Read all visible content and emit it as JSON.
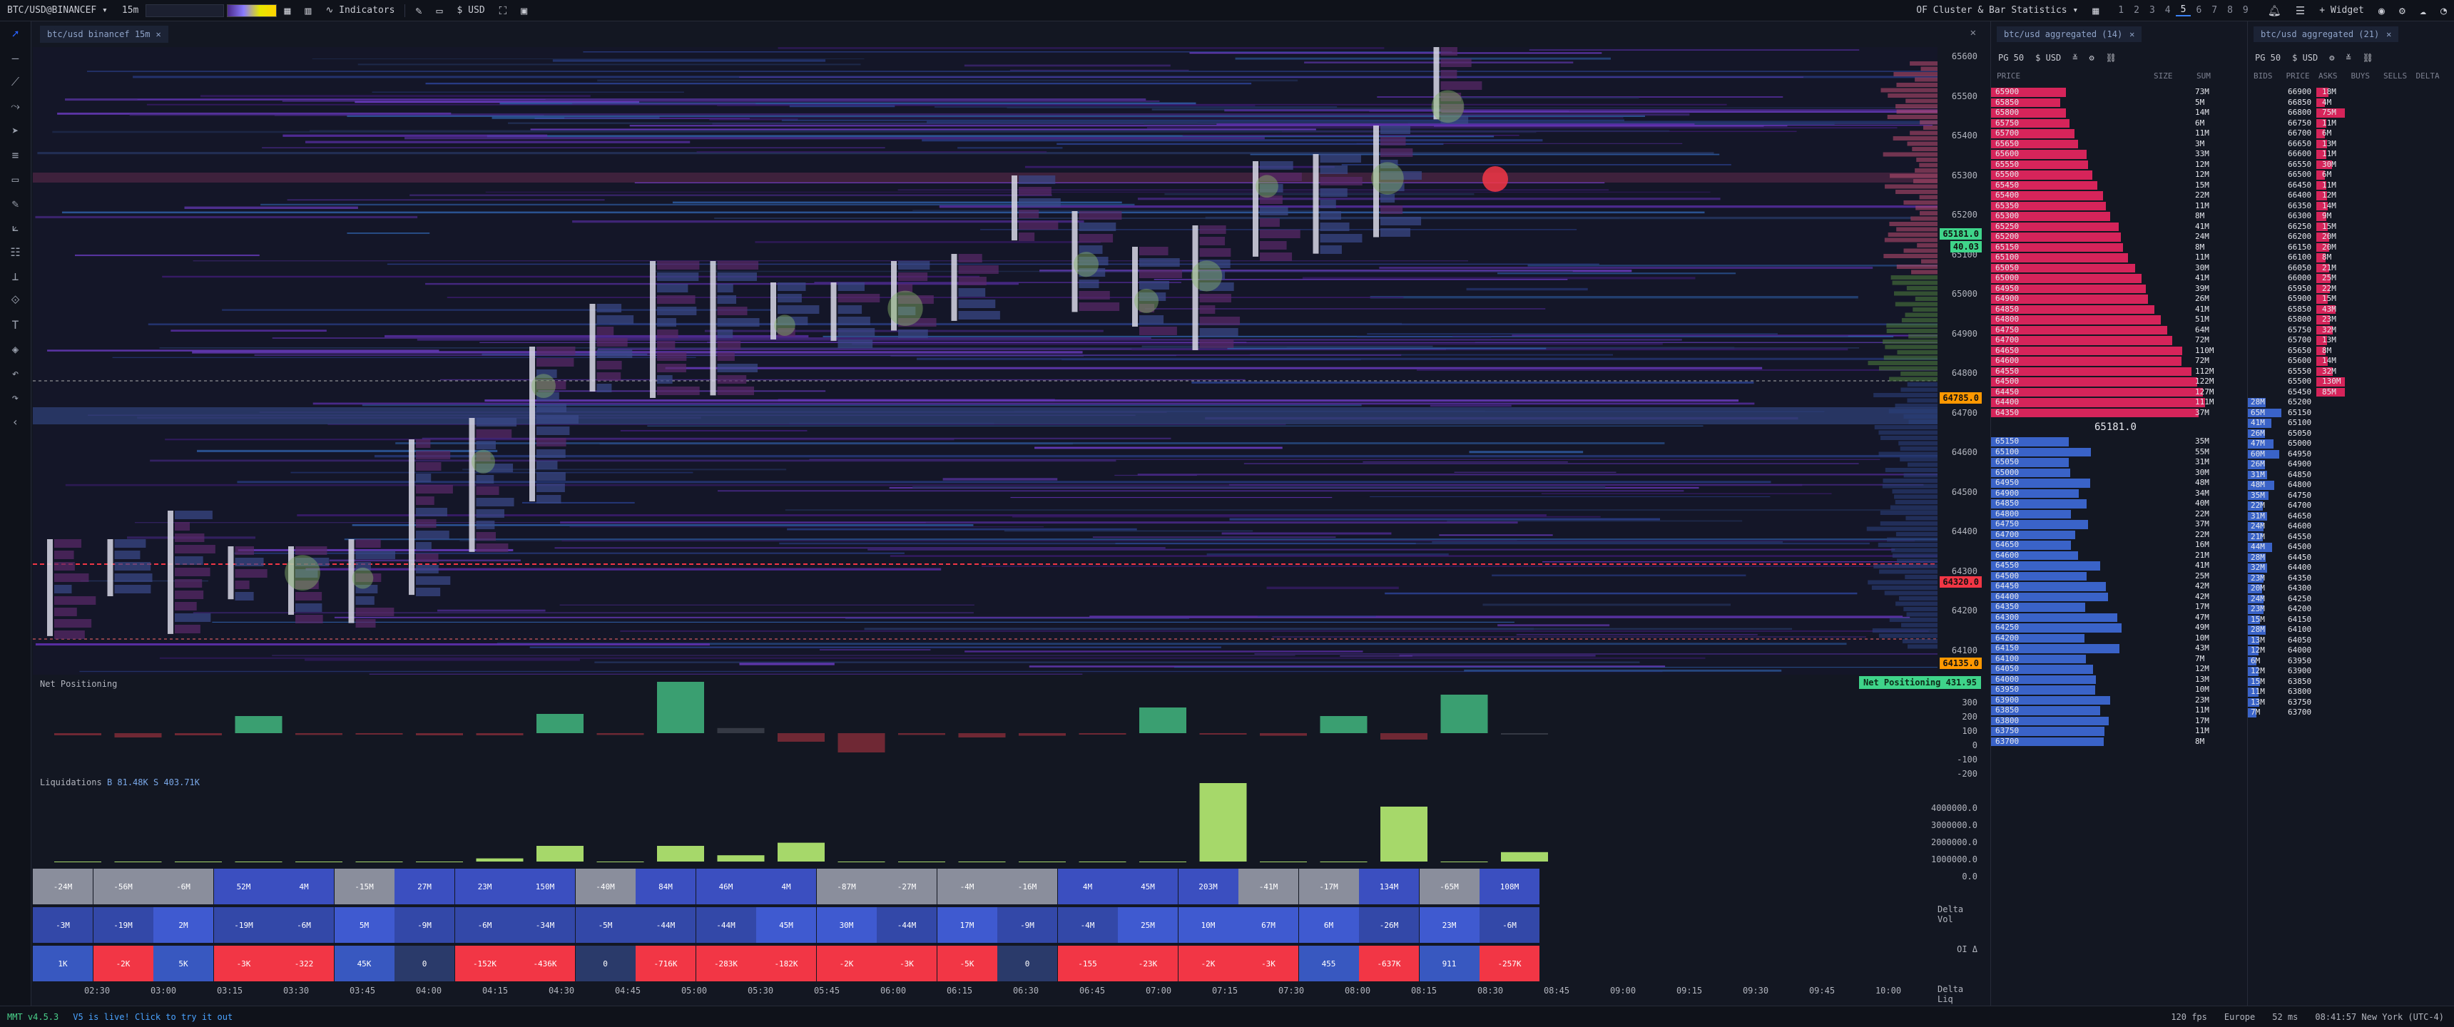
{
  "topbar": {
    "symbol": "BTC/USD@BINANCEF",
    "timeframe": "15m",
    "indicators_label": "Indicators",
    "currency_label": "USD",
    "tool_title": "OF Cluster & Bar Statistics",
    "workspaces": [
      "1",
      "2",
      "3",
      "4",
      "5",
      "6",
      "7",
      "8",
      "9"
    ],
    "active_workspace": "5",
    "widget_label": "Widget"
  },
  "chart": {
    "tab_label": "btc/usd binancef 15m",
    "price_labels": [
      "65600",
      "65500",
      "65400",
      "65300",
      "65200",
      "65100",
      "65000",
      "64900",
      "64800",
      "64700",
      "64600",
      "64500",
      "64400",
      "64300",
      "64200",
      "64100"
    ],
    "markers": [
      {
        "text": "65181.0",
        "color": "#3fd48a"
      },
      {
        "text": "40.03",
        "color": "#3fd48a"
      },
      {
        "text": "64785.0",
        "color": "#ff9800"
      },
      {
        "text": "64320.0",
        "color": "#f23645"
      },
      {
        "text": "64135.0",
        "color": "#ff9800"
      }
    ],
    "net_positioning": {
      "title": "Net Positioning",
      "badge": "Net Positioning 431.95",
      "axis": [
        "300",
        "200",
        "100",
        "0",
        "-100",
        "-200"
      ]
    },
    "liquidations": {
      "title": "Liquidations",
      "buy": "B 81.48K",
      "sell": "S 403.71K",
      "axis": [
        "4000000.0",
        "3000000.0",
        "2000000.0",
        "1000000.0",
        "0.0"
      ]
    },
    "row_labels": [
      "Delta Vol",
      "OI Δ",
      "Delta Liq"
    ],
    "time_labels": [
      "02:30",
      "03:00",
      "03:15",
      "03:30",
      "03:45",
      "04:00",
      "04:15",
      "04:30",
      "04:45",
      "05:00",
      "05:30",
      "05:45",
      "06:00",
      "06:15",
      "06:30",
      "06:45",
      "07:00",
      "07:15",
      "07:30",
      "08:00",
      "08:15",
      "08:30",
      "08:45",
      "09:00",
      "09:15",
      "09:30",
      "09:45",
      "10:00"
    ],
    "delta_vol": [
      "-24M",
      "-56M",
      "-6M",
      "52M",
      "4M",
      "-15M",
      "27M",
      "23M",
      "150M",
      "-40M",
      "84M",
      "46M",
      "4M",
      "-87M",
      "-27M",
      "-4M",
      "-16M",
      "4M",
      "45M",
      "203M",
      "-41M",
      "-17M",
      "134M",
      "-65M",
      "108M"
    ],
    "oi_delta": [
      "-3M",
      "-19M",
      "2M",
      "-19M",
      "-6M",
      "5M",
      "-9M",
      "-6M",
      "-34M",
      "-5M",
      "-44M",
      "-44M",
      "45M",
      "30M",
      "-44M",
      "17M",
      "-9M",
      "-4M",
      "25M",
      "10M",
      "67M",
      "6M",
      "-26M",
      "23M",
      "-6M"
    ],
    "delta_liq": [
      "1K",
      "-2K",
      "5K",
      "-3K",
      "-322",
      "45K",
      "0",
      "-152K",
      "-436K",
      "0",
      "-716K",
      "-283K",
      "-182K",
      "-2K",
      "-3K",
      "-5K",
      "0",
      "-155",
      "-23K",
      "-2K",
      "-3K",
      "455",
      "-637K",
      "911",
      "-257K"
    ]
  },
  "dom1": {
    "tab_label": "btc/usd aggregated (14)",
    "controls": [
      "PG 50",
      "$ USD"
    ],
    "cols": [
      "PRICE",
      "SIZE",
      "SUM"
    ],
    "asks": [
      [
        "65900",
        "73M"
      ],
      [
        "65850",
        "5M"
      ],
      [
        "65800",
        "14M"
      ],
      [
        "65750",
        "6M"
      ],
      [
        "65700",
        "11M"
      ],
      [
        "65650",
        "3M"
      ],
      [
        "65600",
        "33M"
      ],
      [
        "65550",
        "12M"
      ],
      [
        "65500",
        "12M"
      ],
      [
        "65450",
        "15M"
      ],
      [
        "65400",
        "22M"
      ],
      [
        "65350",
        "11M"
      ],
      [
        "65300",
        "8M"
      ],
      [
        "65250",
        "41M"
      ],
      [
        "65200",
        "24M"
      ],
      [
        "65150",
        "8M"
      ],
      [
        "65100",
        "11M"
      ],
      [
        "65050",
        "30M"
      ],
      [
        "65000",
        "41M"
      ],
      [
        "64950",
        "39M"
      ],
      [
        "64900",
        "26M"
      ],
      [
        "64850",
        "41M"
      ],
      [
        "64800",
        "51M"
      ],
      [
        "64750",
        "64M"
      ],
      [
        "64700",
        "72M"
      ],
      [
        "64650",
        "110M"
      ],
      [
        "64600",
        "72M"
      ],
      [
        "64550",
        "112M"
      ],
      [
        "64500",
        "122M"
      ],
      [
        "64450",
        "127M"
      ],
      [
        "64400",
        "111M"
      ],
      [
        "64350",
        "37M"
      ]
    ],
    "mid_price": "65181.0",
    "bids": [
      [
        "65150",
        "35M"
      ],
      [
        "65100",
        "55M"
      ],
      [
        "65050",
        "31M"
      ],
      [
        "65000",
        "30M"
      ],
      [
        "64950",
        "48M"
      ],
      [
        "64900",
        "34M"
      ],
      [
        "64850",
        "40M"
      ],
      [
        "64800",
        "22M"
      ],
      [
        "64750",
        "37M"
      ],
      [
        "64700",
        "22M"
      ],
      [
        "64650",
        "16M"
      ],
      [
        "64600",
        "21M"
      ],
      [
        "64550",
        "41M"
      ],
      [
        "64500",
        "25M"
      ],
      [
        "64450",
        "42M"
      ],
      [
        "64400",
        "42M"
      ],
      [
        "64350",
        "17M"
      ],
      [
        "64300",
        "47M"
      ],
      [
        "64250",
        "49M"
      ],
      [
        "64200",
        "10M"
      ],
      [
        "64150",
        "43M"
      ],
      [
        "64100",
        "7M"
      ],
      [
        "64050",
        "12M"
      ],
      [
        "64000",
        "13M"
      ],
      [
        "63950",
        "10M"
      ],
      [
        "63900",
        "23M"
      ],
      [
        "63850",
        "11M"
      ],
      [
        "63800",
        "17M"
      ],
      [
        "63750",
        "11M"
      ],
      [
        "63700",
        "8M"
      ]
    ]
  },
  "dom2": {
    "tab_label": "btc/usd aggregated (21)",
    "controls": [
      "PG 50",
      "$ USD"
    ],
    "cols": [
      "BIDS",
      "PRICE",
      "ASKS",
      "BUYS",
      "SELLS",
      "DELTA"
    ],
    "asks": [
      [
        "66900",
        "18M"
      ],
      [
        "66850",
        "4M"
      ],
      [
        "66800",
        "75M"
      ],
      [
        "66750",
        "11M"
      ],
      [
        "66700",
        "6M"
      ],
      [
        "66650",
        "13M"
      ],
      [
        "66600",
        "11M"
      ],
      [
        "66550",
        "30M"
      ],
      [
        "66500",
        "6M"
      ],
      [
        "66450",
        "11M"
      ],
      [
        "66400",
        "12M"
      ],
      [
        "66350",
        "14M"
      ],
      [
        "66300",
        "9M"
      ],
      [
        "66250",
        "15M"
      ],
      [
        "66200",
        "20M"
      ],
      [
        "66150",
        "20M"
      ],
      [
        "66100",
        "8M"
      ],
      [
        "66050",
        "21M"
      ],
      [
        "66000",
        "25M"
      ],
      [
        "65950",
        "22M"
      ],
      [
        "65900",
        "15M"
      ],
      [
        "65850",
        "43M"
      ],
      [
        "65800",
        "23M"
      ],
      [
        "65750",
        "32M"
      ],
      [
        "65700",
        "13M"
      ],
      [
        "65650",
        "8M"
      ],
      [
        "65600",
        "14M"
      ],
      [
        "65550",
        "32M"
      ],
      [
        "65500",
        "130M"
      ],
      [
        "65450",
        "85M"
      ]
    ],
    "bids": [
      [
        "65200",
        "28M"
      ],
      [
        "65150",
        "65M"
      ],
      [
        "65100",
        "41M"
      ],
      [
        "65050",
        "26M"
      ],
      [
        "65000",
        "47M"
      ],
      [
        "64950",
        "60M"
      ],
      [
        "64900",
        "26M"
      ],
      [
        "64850",
        "31M"
      ],
      [
        "64800",
        "48M"
      ],
      [
        "64750",
        "35M"
      ],
      [
        "64700",
        "22M"
      ],
      [
        "64650",
        "31M"
      ],
      [
        "64600",
        "24M"
      ],
      [
        "64550",
        "21M"
      ],
      [
        "64500",
        "44M"
      ],
      [
        "64450",
        "28M"
      ],
      [
        "64400",
        "32M"
      ],
      [
        "64350",
        "23M"
      ],
      [
        "64300",
        "20M"
      ],
      [
        "64250",
        "24M"
      ],
      [
        "64200",
        "23M"
      ],
      [
        "64150",
        "15M"
      ],
      [
        "64100",
        "28M"
      ],
      [
        "64050",
        "13M"
      ],
      [
        "64000",
        "12M"
      ],
      [
        "63950",
        "6M"
      ],
      [
        "63900",
        "12M"
      ],
      [
        "63850",
        "15M"
      ],
      [
        "63800",
        "11M"
      ],
      [
        "63750",
        "13M"
      ],
      [
        "63700",
        "7M"
      ]
    ]
  },
  "statusbar": {
    "version": "MMT v4.5.3",
    "live_msg": "V5 is live! Click to try it out",
    "fps": "120 fps",
    "region": "Europe",
    "latency": "52 ms",
    "clock": "08:41:57 New York (UTC-4)"
  },
  "colors": {
    "ask": "#d6245a",
    "bid": "#3a63c8",
    "positive": "#3fd48a",
    "negative": "#f23645"
  }
}
